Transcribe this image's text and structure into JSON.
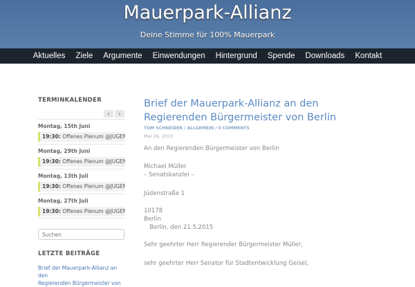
{
  "header": {
    "title": "Mauerpark-Allianz",
    "subtitle": "Deine Stimme für 100% Mauerpark"
  },
  "nav": [
    "Aktuelles",
    "Ziele",
    "Argumente",
    "Einwendungen",
    "Hintergrund",
    "Spende",
    "Downloads",
    "Kontakt"
  ],
  "sidebar": {
    "calendar_title": "TERMINKALENDER",
    "prev": "‹",
    "next": "›",
    "events": [
      {
        "date": "Montag, 15th Juni",
        "time": "19:30:",
        "title": "Offenes Plenum @JUGENDFARM"
      },
      {
        "date": "Montag, 29th Juni",
        "time": "19:30:",
        "title": "Offenes Plenum @JUGENDFARM"
      },
      {
        "date": "Montag, 13th Juli",
        "time": "19:30:",
        "title": "Offenes Plenum @JUGENDFARM"
      },
      {
        "date": "Montag, 27th Juli",
        "time": "19:30:",
        "title": "Offenes Plenum @JUGENDFARM"
      }
    ],
    "search_placeholder": "Suchen",
    "recent_title": "LETZTE BEITRÄGE",
    "recent": [
      "Brief der Mauerpark-Allianz an den",
      "Regierenden Bürgermeister von"
    ]
  },
  "post": {
    "title": "Brief der Mauerpark-Allianz an den Regierenden Bürgermeister von Berlin",
    "author": "TOM SCHNEIDER",
    "category": "ALLGEMEIN",
    "comments": "0 COMMENTS",
    "sep": " / ",
    "date": "Mai 26, 2015",
    "lines": [
      "An den Regierenden Bürgermeister von Berlin",
      "Michael Müller",
      "– Senatskanzlei –",
      "Jüdenstraße 1",
      "10178",
      "Berlin",
      "   Berlin, den 21.5.2015",
      "Sehr geehrter Herr Regierender Bürgermeister Müller,",
      "sehr geehrter Herr Senator für Stadtentwicklung Geisel,"
    ]
  }
}
